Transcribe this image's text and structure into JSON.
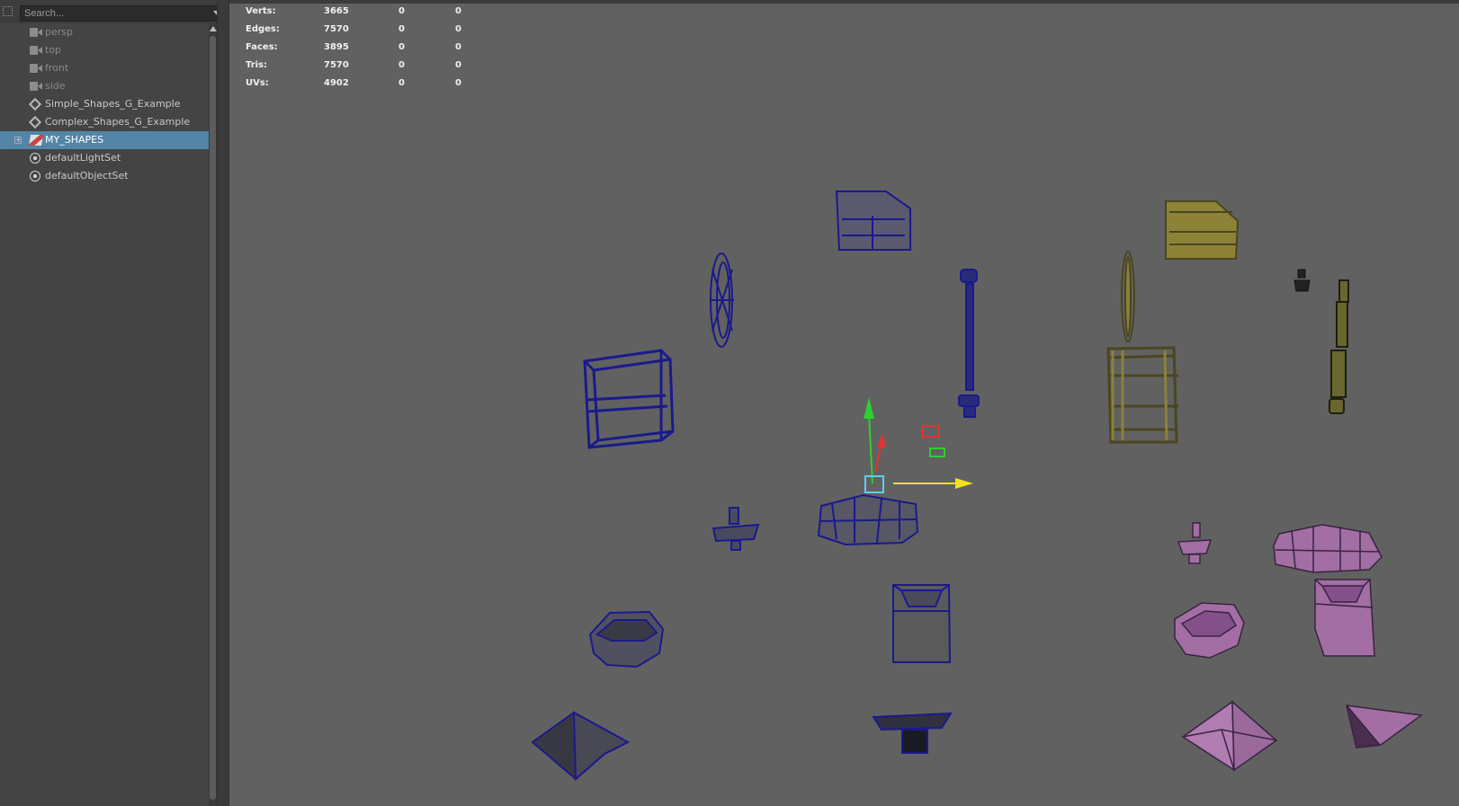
{
  "outliner": {
    "search_placeholder": "Search...",
    "items": [
      {
        "label": "persp",
        "icon": "camera-icon",
        "dim": true
      },
      {
        "label": "top",
        "icon": "camera-icon",
        "dim": true
      },
      {
        "label": "front",
        "icon": "camera-icon",
        "dim": true
      },
      {
        "label": "side",
        "icon": "camera-icon",
        "dim": true
      },
      {
        "label": "Simple_Shapes_G_Example",
        "icon": "set-icon",
        "dim": false
      },
      {
        "label": "Complex_Shapes_G_Example",
        "icon": "set-icon",
        "dim": false
      },
      {
        "label": "MY_SHAPES",
        "icon": "shape-set-icon",
        "dim": false,
        "selected": true
      },
      {
        "label": "defaultLightSet",
        "icon": "light-set-icon",
        "dim": false
      },
      {
        "label": "defaultObjectSet",
        "icon": "object-set-icon",
        "dim": false
      }
    ]
  },
  "hud": {
    "rows": [
      {
        "label": "Verts:",
        "c1": "3665",
        "c2": "0",
        "c3": "0"
      },
      {
        "label": "Edges:",
        "c1": "7570",
        "c2": "0",
        "c3": "0"
      },
      {
        "label": "Faces:",
        "c1": "3895",
        "c2": "0",
        "c3": "0"
      },
      {
        "label": "Tris:",
        "c1": "7570",
        "c2": "0",
        "c3": "0"
      },
      {
        "label": "UVs:",
        "c1": "4902",
        "c2": "0",
        "c3": "0"
      }
    ]
  },
  "colors": {
    "selection": "#5285a6",
    "wire_blue": "#1a1a8c",
    "wire_yellow": "#6e6a2c",
    "shape_pink": "#9c6b9e",
    "viewport_bg": "#616161"
  }
}
